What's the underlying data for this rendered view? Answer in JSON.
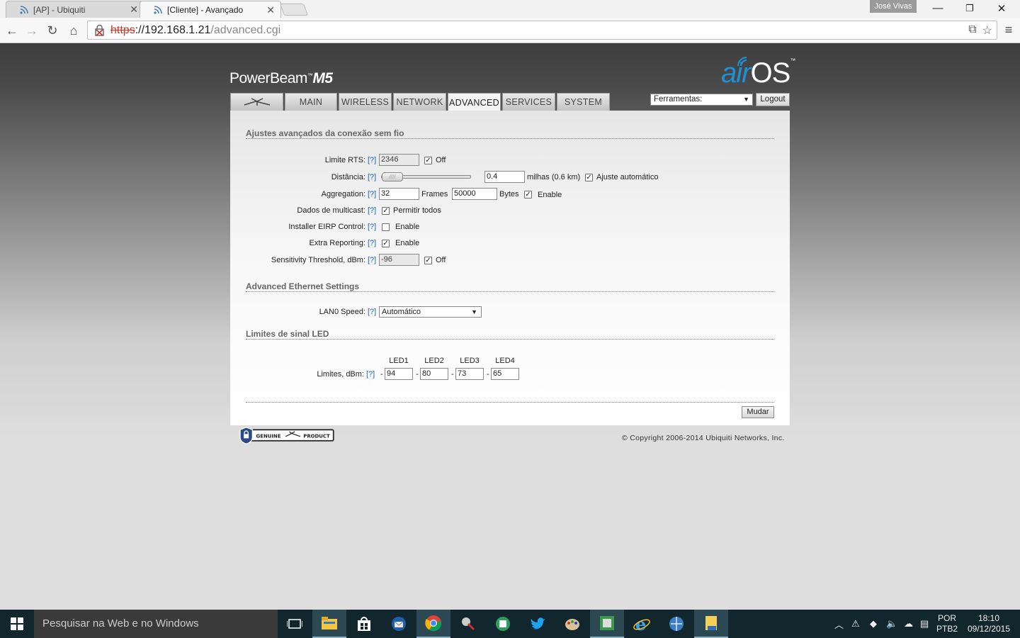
{
  "browser": {
    "tabs": [
      {
        "title": "[AP] - Ubiquiti",
        "active": false
      },
      {
        "title": "[Cliente] - Avançado",
        "active": true
      }
    ],
    "profile_name": "José Vivas",
    "url_scheme": "https",
    "url_host": "://192.168.1.21",
    "url_path": "/advanced.cgi"
  },
  "header": {
    "product": "PowerBeam",
    "product_tm": "™",
    "model": "M5",
    "brand_air": "air",
    "brand_os": "OS",
    "brand_tm": "™",
    "tools_select": "Ferramentas:",
    "logout_label": "Logout"
  },
  "main_tabs": [
    {
      "label": "",
      "active": false
    },
    {
      "label": "MAIN",
      "active": false
    },
    {
      "label": "WIRELESS",
      "active": false
    },
    {
      "label": "NETWORK",
      "active": false
    },
    {
      "label": "ADVANCED",
      "active": true
    },
    {
      "label": "SERVICES",
      "active": false
    },
    {
      "label": "SYSTEM",
      "active": false
    }
  ],
  "wireless_section": {
    "title": "Ajustes avançados da conexão sem fio",
    "help": "[?]",
    "rts_label": "Limite RTS:",
    "rts_value": "2346",
    "rts_off_label": "Off",
    "rts_off_checked": true,
    "distance_label": "Distância:",
    "distance_value": "0.4",
    "distance_units": "milhas (0.6 km)",
    "auto_adjust_label": "Ajuste automático",
    "auto_adjust_checked": true,
    "aggregation_label": "Aggregation:",
    "aggregation_frames": "32",
    "frames_label": "Frames",
    "aggregation_bytes": "50000",
    "bytes_label": "Bytes",
    "aggregation_enable_label": "Enable",
    "aggregation_enable_checked": true,
    "multicast_label": "Dados de multicast:",
    "multicast_allow_label": "Permitir todos",
    "multicast_checked": true,
    "eirp_label": "Installer EIRP Control:",
    "eirp_enable_label": "Enable",
    "eirp_checked": false,
    "extra_reporting_label": "Extra Reporting:",
    "extra_reporting_enable_label": "Enable",
    "extra_reporting_checked": true,
    "sensitivity_label": "Sensitivity Threshold, dBm:",
    "sensitivity_value": "-96",
    "sensitivity_off_label": "Off",
    "sensitivity_off_checked": true
  },
  "ethernet_section": {
    "title": "Advanced Ethernet Settings",
    "lan_speed_label": "LAN0 Speed:",
    "lan_speed_value": "Automático"
  },
  "led_section": {
    "title": "Limites de sinal LED",
    "headers": [
      "LED1",
      "LED2",
      "LED3",
      "LED4"
    ],
    "limits_label": "Limites, dBm:",
    "dash": "-",
    "values": [
      "94",
      "80",
      "73",
      "65"
    ]
  },
  "footer": {
    "apply_label": "Mudar",
    "genuine_text": "GENUINE",
    "product_text": "PRODUCT",
    "copyright": "© Copyright 2006-2014 Ubiquiti Networks, Inc."
  },
  "taskbar": {
    "search_placeholder": "Pesquisar na Web e no Windows",
    "language": "POR",
    "layout": "PTB2",
    "time": "18:10",
    "date": "09/12/2015"
  },
  "colors": {
    "help_link": "#1a64c8",
    "brand_blue": "#1f8fd6",
    "taskbar": "#12262e"
  }
}
